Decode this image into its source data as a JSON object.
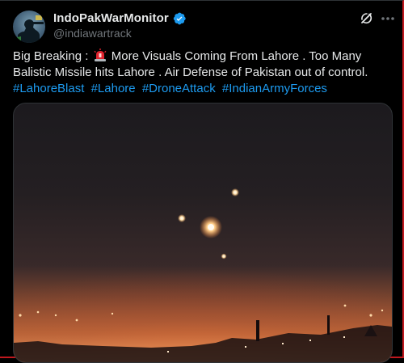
{
  "author": {
    "display_name": "IndoPakWarMonitor",
    "handle": "@indiawartrack",
    "verified": true,
    "avatar_icon": "avatar-soldier-silhouette"
  },
  "tweet": {
    "text_before_emoji": "Big Breaking : ",
    "emoji": "siren-emoji",
    "text_after_emoji": " More Visuals Coming From Lahore . Too Many Balistic Missile hits Lahore . Air Defense of Pakistan out of control.",
    "hashtags": [
      "#LahoreBlast",
      "#Lahore",
      "#DroneAttack",
      "#IndianArmyForces"
    ]
  },
  "actions": {
    "grok_icon": "grok-icon",
    "more_icon": "more-options-icon"
  },
  "media": {
    "type": "video",
    "description_icon": "night-sky-lights"
  },
  "colors": {
    "background": "#000000",
    "text": "#e7e9ea",
    "secondary_text": "#71767b",
    "link": "#1d9bf0",
    "verified": "#1d9bf0",
    "frame_border": "#c0181e"
  }
}
